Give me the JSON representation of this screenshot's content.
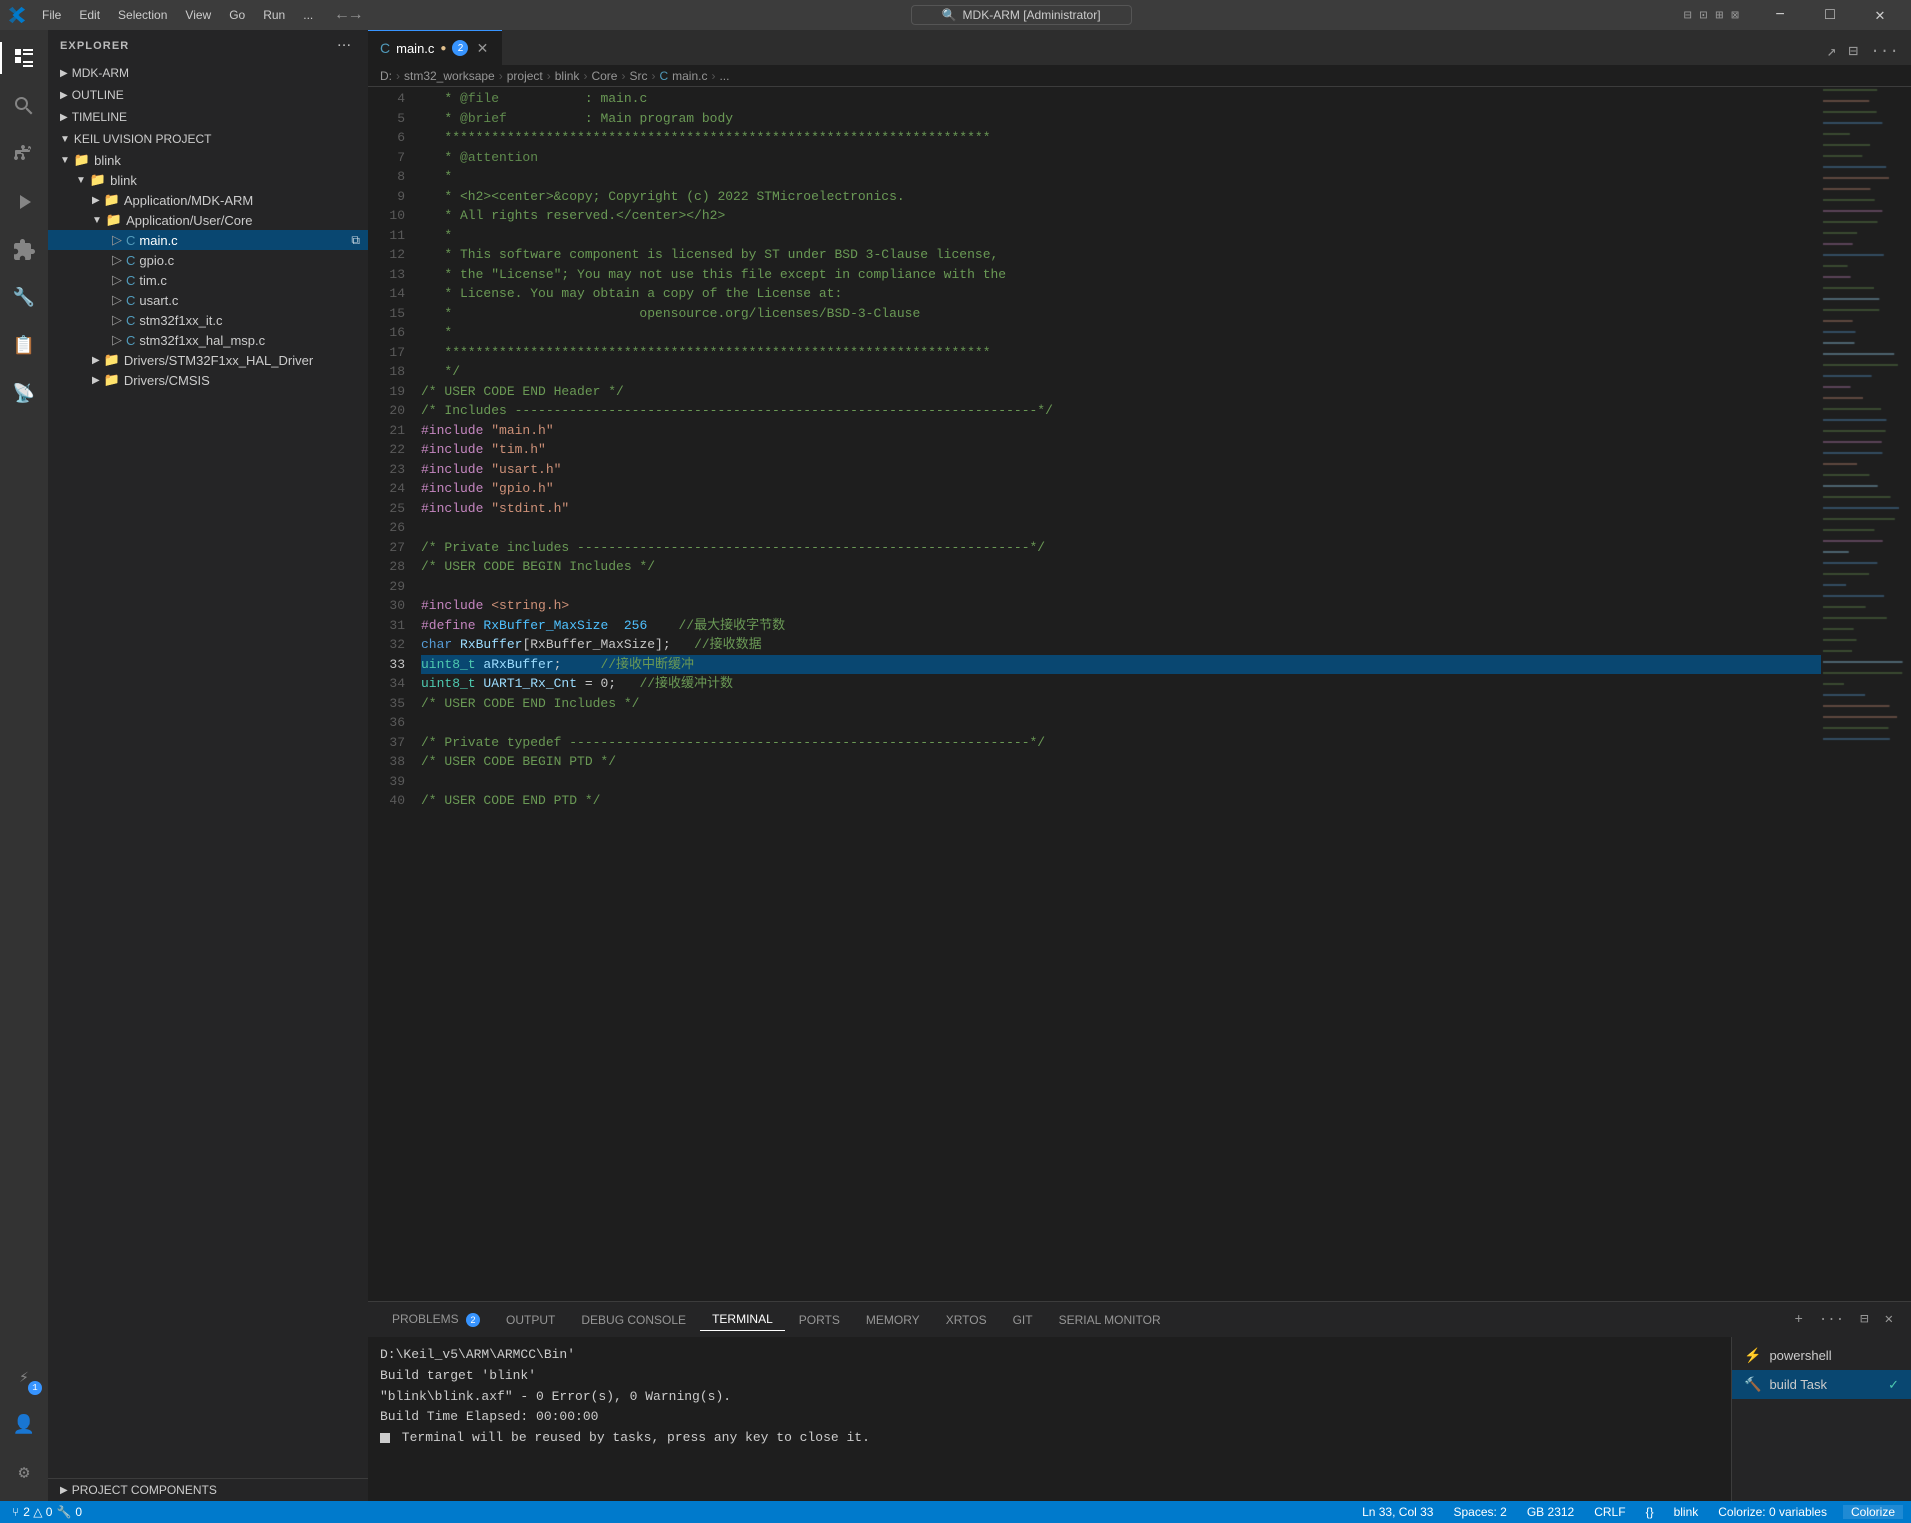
{
  "titleBar": {
    "appName": "MDK-ARM [Administrator]",
    "menus": [
      "File",
      "Edit",
      "Selection",
      "View",
      "Go",
      "Run",
      "..."
    ],
    "winControls": [
      "minimize",
      "maximize",
      "close"
    ]
  },
  "activityBar": {
    "items": [
      {
        "name": "explorer",
        "icon": "📁",
        "active": true
      },
      {
        "name": "search",
        "icon": "🔍",
        "active": false
      },
      {
        "name": "source-control",
        "icon": "⑂",
        "active": false
      },
      {
        "name": "run-debug",
        "icon": "▷",
        "active": false
      },
      {
        "name": "extensions",
        "icon": "⊞",
        "active": false
      },
      {
        "name": "keil-uvision",
        "icon": "🔧",
        "active": false
      },
      {
        "name": "serial-monitor",
        "icon": "📡",
        "active": false
      },
      {
        "name": "build",
        "icon": "🔨",
        "active": false
      }
    ],
    "bottomItems": [
      {
        "name": "remote",
        "icon": "⧗",
        "badge": "1"
      },
      {
        "name": "accounts",
        "icon": "👤"
      },
      {
        "name": "settings",
        "icon": "⚙"
      }
    ]
  },
  "sidebar": {
    "title": "EXPLORER",
    "sections": [
      {
        "name": "MDK-ARM",
        "expanded": true
      },
      {
        "name": "OUTLINE",
        "expanded": false
      },
      {
        "name": "TIMELINE",
        "expanded": false
      },
      {
        "name": "KEIL UVISION PROJECT",
        "expanded": true,
        "tree": [
          {
            "level": 1,
            "type": "folder",
            "name": "blink",
            "expanded": true
          },
          {
            "level": 2,
            "type": "folder",
            "name": "blink",
            "expanded": true
          },
          {
            "level": 3,
            "type": "folder",
            "name": "Application/MDK-ARM",
            "expanded": false
          },
          {
            "level": 3,
            "type": "folder",
            "name": "Application/User/Core",
            "expanded": true
          },
          {
            "level": 4,
            "type": "file-c",
            "name": "main.c",
            "active": true
          },
          {
            "level": 4,
            "type": "file-c",
            "name": "gpio.c"
          },
          {
            "level": 4,
            "type": "file-c",
            "name": "tim.c"
          },
          {
            "level": 4,
            "type": "file-c",
            "name": "usart.c"
          },
          {
            "level": 4,
            "type": "file-c",
            "name": "stm32f1xx_it.c"
          },
          {
            "level": 4,
            "type": "file-c",
            "name": "stm32f1xx_hal_msp.c"
          },
          {
            "level": 3,
            "type": "folder",
            "name": "Drivers/STM32F1xx_HAL_Driver",
            "expanded": false
          },
          {
            "level": 3,
            "type": "folder",
            "name": "Drivers/CMSIS",
            "expanded": false
          }
        ]
      }
    ],
    "projectComponents": "PROJECT COMPONENTS"
  },
  "editor": {
    "tab": {
      "icon": "C",
      "filename": "main.c",
      "modified": true,
      "badge": "2"
    },
    "breadcrumb": [
      "D:",
      "stm32_worksape",
      "project",
      "blink",
      "Core",
      "Src",
      "C main.c",
      "..."
    ],
    "lines": [
      {
        "num": 4,
        "content": [
          {
            "text": "   * ",
            "cls": "stars"
          },
          {
            "text": "@file",
            "cls": "annotation"
          },
          {
            "text": "           : main.c",
            "cls": "cmt"
          }
        ]
      },
      {
        "num": 5,
        "content": [
          {
            "text": "   * ",
            "cls": "stars"
          },
          {
            "text": "@brief",
            "cls": "annotation"
          },
          {
            "text": "          : Main program body",
            "cls": "cmt"
          }
        ]
      },
      {
        "num": 6,
        "content": [
          {
            "text": "   **********************************************************************",
            "cls": "stars"
          }
        ]
      },
      {
        "num": 7,
        "content": [
          {
            "text": "   * ",
            "cls": "stars"
          },
          {
            "text": "@attention",
            "cls": "annotation"
          }
        ]
      },
      {
        "num": 8,
        "content": [
          {
            "text": "   *",
            "cls": "stars"
          }
        ]
      },
      {
        "num": 9,
        "content": [
          {
            "text": "   * <h2><center>&copy; Copyright (c) 2022 STMicroelectronics.",
            "cls": "cmt"
          }
        ]
      },
      {
        "num": 10,
        "content": [
          {
            "text": "   * All rights reserved.</center></h2>",
            "cls": "cmt"
          }
        ]
      },
      {
        "num": 11,
        "content": [
          {
            "text": "   *",
            "cls": "stars"
          }
        ]
      },
      {
        "num": 12,
        "content": [
          {
            "text": "   * This software component is licensed by ST under BSD 3-Clause license,",
            "cls": "cmt"
          }
        ]
      },
      {
        "num": 13,
        "content": [
          {
            "text": "   * the \"License\"; You may not use this file except in compliance with the",
            "cls": "cmt"
          }
        ]
      },
      {
        "num": 14,
        "content": [
          {
            "text": "   * License. You may obtain a copy of the License at:",
            "cls": "cmt"
          }
        ]
      },
      {
        "num": 15,
        "content": [
          {
            "text": "   *                        opensource.org/licenses/BSD-3-Clause",
            "cls": "cmt"
          }
        ]
      },
      {
        "num": 16,
        "content": [
          {
            "text": "   *",
            "cls": "stars"
          }
        ]
      },
      {
        "num": 17,
        "content": [
          {
            "text": "   **********************************************************************",
            "cls": "stars"
          }
        ]
      },
      {
        "num": 18,
        "content": [
          {
            "text": "   */",
            "cls": "cmt"
          }
        ]
      },
      {
        "num": 19,
        "content": [
          {
            "text": "/* USER CODE END Header */",
            "cls": "cmt"
          }
        ]
      },
      {
        "num": 20,
        "content": [
          {
            "text": "/* Includes -------------------------------------------------------------------*/",
            "cls": "cmt"
          }
        ]
      },
      {
        "num": 21,
        "content": [
          {
            "text": "#include ",
            "cls": "define"
          },
          {
            "text": "\"main.h\"",
            "cls": "str"
          }
        ]
      },
      {
        "num": 22,
        "content": [
          {
            "text": "#include ",
            "cls": "define"
          },
          {
            "text": "\"tim.h\"",
            "cls": "str"
          }
        ]
      },
      {
        "num": 23,
        "content": [
          {
            "text": "#include ",
            "cls": "define"
          },
          {
            "text": "\"usart.h\"",
            "cls": "str"
          }
        ]
      },
      {
        "num": 24,
        "content": [
          {
            "text": "#include ",
            "cls": "define"
          },
          {
            "text": "\"gpio.h\"",
            "cls": "str"
          }
        ]
      },
      {
        "num": 25,
        "content": [
          {
            "text": "#include ",
            "cls": "define"
          },
          {
            "text": "\"stdint.h\"",
            "cls": "str"
          }
        ]
      },
      {
        "num": 26,
        "content": []
      },
      {
        "num": 27,
        "content": [
          {
            "text": "/* Private includes ----------------------------------------------------------*/",
            "cls": "cmt"
          }
        ]
      },
      {
        "num": 28,
        "content": [
          {
            "text": "/* USER CODE BEGIN Includes */",
            "cls": "cmt"
          }
        ]
      },
      {
        "num": 29,
        "content": []
      },
      {
        "num": 30,
        "content": [
          {
            "text": "#include ",
            "cls": "define"
          },
          {
            "text": "<string.h>",
            "cls": "str"
          }
        ]
      },
      {
        "num": 31,
        "content": [
          {
            "text": "#define ",
            "cls": "define"
          },
          {
            "text": "RxBuffer_MaxSize  256    ",
            "cls": "macro"
          },
          {
            "text": "//最大接收字节数",
            "cls": "cmt"
          }
        ]
      },
      {
        "num": 32,
        "content": [
          {
            "text": "char ",
            "cls": "kw"
          },
          {
            "text": "RxBuffer",
            "cls": "var"
          },
          {
            "text": "[RxBuffer_MaxSize];   ",
            "cls": "ann"
          },
          {
            "text": "//接收数据",
            "cls": "cmt"
          }
        ]
      },
      {
        "num": 33,
        "content": [
          {
            "text": "uint8_t ",
            "cls": "type"
          },
          {
            "text": "aRxBuffer",
            "cls": "var"
          },
          {
            "text": ";     ",
            "cls": "ann"
          },
          {
            "text": "//接收中断缓冲",
            "cls": "cmt"
          }
        ],
        "highlighted": true
      },
      {
        "num": 34,
        "content": [
          {
            "text": "uint8_t ",
            "cls": "type"
          },
          {
            "text": "UART1_Rx_Cnt ",
            "cls": "var"
          },
          {
            "text": "= 0;   ",
            "cls": "ann"
          },
          {
            "text": "//接收缓冲计数",
            "cls": "cmt"
          }
        ]
      },
      {
        "num": 35,
        "content": [
          {
            "text": "/* USER CODE END Includes */",
            "cls": "cmt"
          }
        ]
      },
      {
        "num": 36,
        "content": []
      },
      {
        "num": 37,
        "content": [
          {
            "text": "/* Private typedef -----------------------------------------------------------*/",
            "cls": "cmt"
          }
        ]
      },
      {
        "num": 38,
        "content": [
          {
            "text": "/* USER CODE BEGIN PTD */",
            "cls": "cmt"
          }
        ]
      },
      {
        "num": 39,
        "content": []
      },
      {
        "num": 40,
        "content": [
          {
            "text": "/* USER CODE END PTD */",
            "cls": "cmt"
          }
        ]
      }
    ],
    "activeLineNum": 33
  },
  "panel": {
    "tabs": [
      {
        "label": "PROBLEMS",
        "badge": "2",
        "active": false
      },
      {
        "label": "OUTPUT",
        "badge": null,
        "active": false
      },
      {
        "label": "DEBUG CONSOLE",
        "badge": null,
        "active": false
      },
      {
        "label": "TERMINAL",
        "badge": null,
        "active": true
      },
      {
        "label": "PORTS",
        "badge": null,
        "active": false
      },
      {
        "label": "MEMORY",
        "badge": null,
        "active": false
      },
      {
        "label": "XRTOS",
        "badge": null,
        "active": false
      },
      {
        "label": "GIT",
        "badge": null,
        "active": false
      },
      {
        "label": "SERIAL MONITOR",
        "badge": null,
        "active": false
      }
    ],
    "terminal": {
      "lines": [
        "D:\\Keil_v5\\ARM\\ARMCC\\Bin'",
        "Build target 'blink'",
        "\"blink\\blink.axf\" - 0 Error(s), 0 Warning(s).",
        "Build Time Elapsed:  00:00:00",
        "▪ Terminal will be reused by tasks, press any key to close it."
      ]
    },
    "rightPanel": {
      "items": [
        {
          "icon": "⚡",
          "label": "powershell",
          "active": false
        },
        {
          "icon": "🔨",
          "label": "build  Task",
          "active": true,
          "check": true
        }
      ]
    }
  },
  "statusBar": {
    "left": [
      {
        "text": "⑂ 2 △ 0  🔧 0",
        "type": "vcs"
      }
    ],
    "right": [
      {
        "text": "Ln 33, Col 33"
      },
      {
        "text": "Spaces: 2"
      },
      {
        "text": "GB 2312"
      },
      {
        "text": "CRLF"
      },
      {
        "text": "{}"
      },
      {
        "text": "blink"
      },
      {
        "text": "Colorize: 0 variables"
      },
      {
        "text": "Colorize"
      }
    ]
  }
}
